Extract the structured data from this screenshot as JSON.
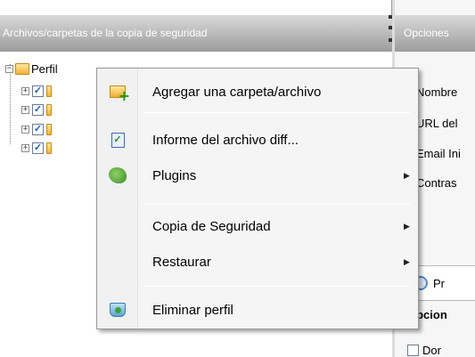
{
  "left_panel": {
    "header": "Archivos/carpetas de la copia de seguridad",
    "root_label": "Perfil"
  },
  "right_panel": {
    "header": "Opciones",
    "labels": [
      "Nombre",
      "URL del",
      "Email Ini",
      "Contras"
    ],
    "progress_label": "Pr",
    "options_title": "Opcion",
    "checkbox_label": "Dor"
  },
  "context_menu": {
    "items": [
      {
        "label": "Agregar una carpeta/archivo",
        "icon": "add-folder-icon",
        "submenu": false
      },
      {
        "label": "Informe del archivo diff...",
        "icon": "report-icon",
        "submenu": false
      },
      {
        "label": "Plugins",
        "icon": "plugin-icon",
        "submenu": true
      },
      {
        "label": "Copia de Seguridad",
        "icon": "",
        "submenu": true
      },
      {
        "label": "Restaurar",
        "icon": "",
        "submenu": true
      },
      {
        "label": "Eliminar perfil",
        "icon": "delete-profile-icon",
        "submenu": false
      }
    ]
  },
  "colors": {
    "header_gradient_top": "#dadada",
    "header_gradient_bottom": "#9c9c9c",
    "menu_bg": "#f5f5f5",
    "folder": "#f2b33a"
  }
}
